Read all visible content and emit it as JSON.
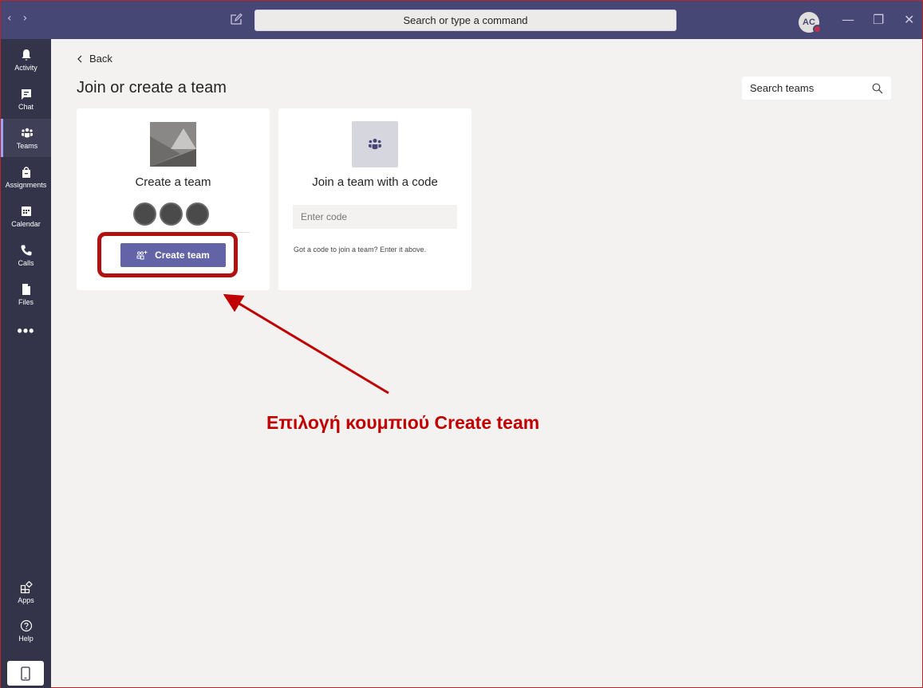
{
  "titlebar": {
    "back_arrow": "‹",
    "forward_arrow": "›",
    "command_placeholder": "Search or type a command",
    "avatar_initials": "AC",
    "minimize": "—",
    "maximize": "❐",
    "close": "✕"
  },
  "rail": {
    "items": [
      {
        "label": "Activity",
        "icon": "bell-icon"
      },
      {
        "label": "Chat",
        "icon": "chat-icon"
      },
      {
        "label": "Teams",
        "icon": "teams-icon"
      },
      {
        "label": "Assignments",
        "icon": "assignments-icon"
      },
      {
        "label": "Calendar",
        "icon": "calendar-icon"
      },
      {
        "label": "Calls",
        "icon": "phone-icon"
      },
      {
        "label": "Files",
        "icon": "file-icon"
      },
      {
        "label": "Apps",
        "icon": "apps-icon"
      },
      {
        "label": "Help",
        "icon": "help-icon"
      }
    ],
    "more": "•••",
    "active": "Teams"
  },
  "main": {
    "back_label": "Back",
    "title": "Join or create a team",
    "search_placeholder": "Search teams"
  },
  "create_card": {
    "title": "Create a team",
    "button_label": "Create team"
  },
  "join_card": {
    "title": "Join a team with a code",
    "code_placeholder": "Enter code",
    "help_text": "Got a code to join a team? Enter it above."
  },
  "annotation": {
    "text": "Επιλογή κουμπιού Create team",
    "color": "#c00000"
  },
  "colors": {
    "titlebar": "#464775",
    "rail": "#33344a",
    "accent": "#6264a7",
    "highlight": "#b01111"
  }
}
